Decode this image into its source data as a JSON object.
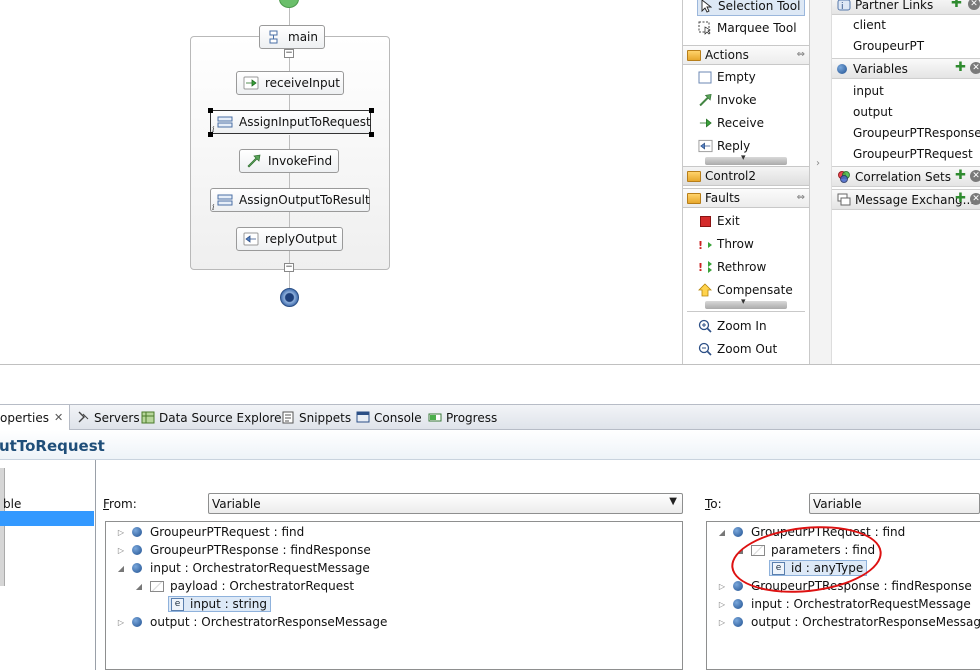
{
  "canvas": {
    "sequence_label": "main",
    "activities": [
      {
        "label": "receiveInput",
        "icon": "receive-icon"
      },
      {
        "label": "AssignInputToRequest",
        "icon": "assign-icon",
        "selected": true
      },
      {
        "label": "InvokeFind",
        "icon": "invoke-icon"
      },
      {
        "label": "AssignOutputToResult",
        "icon": "assign-icon"
      },
      {
        "label": "replyOutput",
        "icon": "reply-icon"
      }
    ]
  },
  "palette": {
    "tools": [
      {
        "label": "Selection Tool",
        "icon": "arrow-cursor-icon"
      },
      {
        "label": "Marquee Tool",
        "icon": "marquee-icon"
      }
    ],
    "actions_drawer": "Actions",
    "actions": [
      {
        "label": "Empty",
        "icon": "empty-icon"
      },
      {
        "label": "Invoke",
        "icon": "invoke-icon"
      },
      {
        "label": "Receive",
        "icon": "receive-icon"
      },
      {
        "label": "Reply",
        "icon": "reply-icon"
      }
    ],
    "control_drawer": "Control2",
    "faults_drawer": "Faults",
    "faults": [
      {
        "label": "Exit",
        "icon": "exit-icon"
      },
      {
        "label": "Throw",
        "icon": "throw-icon"
      },
      {
        "label": "Rethrow",
        "icon": "rethrow-icon"
      },
      {
        "label": "Compensate",
        "icon": "compensate-icon"
      }
    ],
    "zoom": [
      {
        "label": "Zoom In",
        "icon": "zoom-in-icon"
      },
      {
        "label": "Zoom Out",
        "icon": "zoom-out-icon"
      }
    ]
  },
  "outline": {
    "partner_links": {
      "title": "Partner Links",
      "items": [
        "client",
        "GroupeurPT"
      ]
    },
    "variables": {
      "title": "Variables",
      "items": [
        "input",
        "output",
        "GroupeurPTResponse",
        "GroupeurPTRequest"
      ]
    },
    "correlation_sets": {
      "title": "Correlation Sets"
    },
    "message_exchanges": {
      "title": "Message Exchang..."
    }
  },
  "bottom_tabs": {
    "properties": "operties",
    "servers": "Servers",
    "data_source_explorer": "Data Source Explorer",
    "snippets": "Snippets",
    "console": "Console",
    "progress": "Progress"
  },
  "properties": {
    "title": "utToRequest",
    "left_list_label": "ble",
    "from": {
      "label_first": "F",
      "label_rest": "rom:",
      "type": "Variable",
      "tree": [
        {
          "label": "GroupeurPTRequest : find",
          "expander": "closed",
          "icon": "variable-icon",
          "depth": 0
        },
        {
          "label": "GroupeurPTResponse : findResponse",
          "expander": "closed",
          "icon": "variable-icon",
          "depth": 0
        },
        {
          "label": "input : OrchestratorRequestMessage",
          "expander": "open",
          "icon": "variable-icon",
          "depth": 0
        },
        {
          "label": "payload : OrchestratorRequest",
          "expander": "open",
          "icon": "message-part-icon",
          "depth": 1
        },
        {
          "label": "input : string",
          "expander": "none",
          "icon": "element-icon",
          "depth": 2,
          "highlighted": true
        },
        {
          "label": "output : OrchestratorResponseMessage",
          "expander": "closed",
          "icon": "variable-icon",
          "depth": 0
        }
      ]
    },
    "to": {
      "label_first": "T",
      "label_rest": "o:",
      "type": "Variable",
      "tree": [
        {
          "label": "GroupeurPTRequest : find",
          "expander": "open",
          "icon": "variable-icon",
          "depth": 0
        },
        {
          "label": "parameters : find",
          "expander": "open",
          "icon": "message-part-icon",
          "depth": 1
        },
        {
          "label": "id : anyType",
          "expander": "none",
          "icon": "element-icon",
          "depth": 2,
          "highlighted": true
        },
        {
          "label": "GroupeurPTResponse : findResponse",
          "expander": "closed",
          "icon": "variable-icon",
          "depth": 0
        },
        {
          "label": "input : OrchestratorRequestMessage",
          "expander": "closed",
          "icon": "variable-icon",
          "depth": 0
        },
        {
          "label": "output : OrchestratorResponseMessage",
          "expander": "closed",
          "icon": "variable-icon",
          "depth": 0
        }
      ]
    },
    "element_icon_letter": "e"
  }
}
